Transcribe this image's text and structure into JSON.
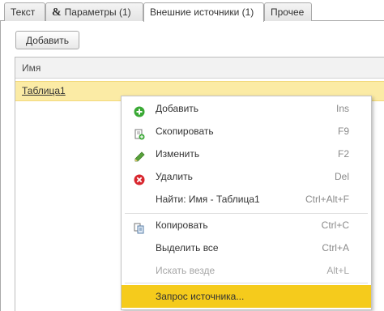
{
  "tabs": [
    {
      "label": "Текст"
    },
    {
      "label": "Параметры (1)"
    },
    {
      "label": "Внешние источники (1)"
    },
    {
      "label": "Прочее"
    }
  ],
  "tab_params_symbol": "&",
  "toolbar": {
    "add_label": "Добавить"
  },
  "table": {
    "column_name": "Имя",
    "rows": [
      {
        "name": "Таблица1"
      }
    ]
  },
  "context_menu": {
    "items": [
      {
        "label": "Добавить",
        "shortcut": "Ins",
        "icon": "add-icon"
      },
      {
        "label": "Скопировать",
        "shortcut": "F9",
        "icon": "copy-row-icon"
      },
      {
        "label": "Изменить",
        "shortcut": "F2",
        "icon": "pencil-icon"
      },
      {
        "label": "Удалить",
        "shortcut": "Del",
        "icon": "delete-icon"
      },
      {
        "label": "Найти: Имя - Таблица1",
        "shortcut": "Ctrl+Alt+F",
        "icon": ""
      },
      {
        "label": "Копировать",
        "shortcut": "Ctrl+C",
        "icon": "clipboard-copy-icon"
      },
      {
        "label": "Выделить все",
        "shortcut": "Ctrl+A",
        "icon": ""
      },
      {
        "label": "Искать везде",
        "shortcut": "Alt+L",
        "icon": ""
      },
      {
        "label": "Запрос источника...",
        "shortcut": "",
        "icon": ""
      }
    ]
  },
  "colors": {
    "selected_row": "#fbeba5",
    "menu_highlight": "#f5cb1c",
    "add_green": "#3aa935",
    "delete_red": "#d8262e"
  }
}
